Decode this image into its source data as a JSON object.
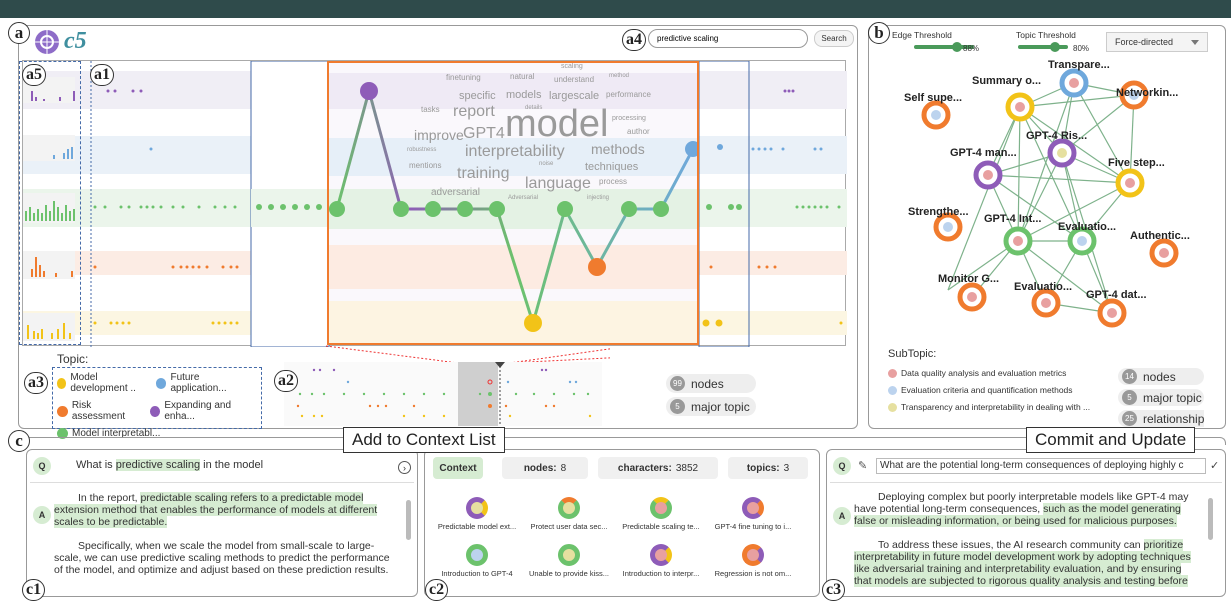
{
  "app": {
    "logo": "c5"
  },
  "labels": {
    "a": "a",
    "a1": "a1",
    "a2": "a2",
    "a3": "a3",
    "a4": "a4",
    "a5": "a5",
    "b": "b",
    "c": "c",
    "c1": "c1",
    "c2": "c2",
    "c3": "c3"
  },
  "search": {
    "value": "predictive scaling",
    "button": "Search"
  },
  "topics": {
    "title": "Topic:",
    "items": [
      {
        "label": "Model development ..",
        "color": "#f2c318"
      },
      {
        "label": "Future application...",
        "color": "#6fa8dc"
      },
      {
        "label": "Risk assessment",
        "color": "#f07b2e"
      },
      {
        "label": "Expanding and enha...",
        "color": "#8e5cb8"
      },
      {
        "label": "Model interpretabl...",
        "color": "#6cc26c"
      }
    ]
  },
  "stats_a": {
    "nodes": "99",
    "nodes_label": "nodes",
    "topics": "5",
    "topics_label": "major topic"
  },
  "wordcloud": [
    "scaling",
    "finetuning",
    "natural",
    "understand",
    "method",
    "specific",
    "models",
    "largescale",
    "performance",
    "tasks",
    "report",
    "details",
    "processing",
    "improve",
    "GPT4",
    "model",
    "author",
    "robustness",
    "interpretability",
    "methods",
    "mentions",
    "noise",
    "techniques",
    "training",
    "process",
    "language",
    "adversarial",
    "Adversarial",
    "injecting"
  ],
  "graph": {
    "edge_threshold_label": "Edge Threshold",
    "edge_threshold": "88%",
    "topic_threshold_label": "Topic Threshold",
    "topic_threshold": "80%",
    "layout": "Force-directed",
    "nodes": [
      "Transpare...",
      "Summary o...",
      "Networkin...",
      "Self supe...",
      "GPT-4 Ris...",
      "GPT-4 man...",
      "Five step...",
      "Strengthe...",
      "GPT-4 Int...",
      "Evaluatio...",
      "Authentic...",
      "Monitor G...",
      "Evaluatio...",
      "GPT-4 dat..."
    ],
    "subtopic_title": "SubTopic:",
    "subtopics": [
      {
        "label": "Data quality analysis and evaluation metrics",
        "color": "#e8a0a0"
      },
      {
        "label": "Evaluation criteria and quantification methods",
        "color": "#bcd3ee"
      },
      {
        "label": "Transparency and interpretability in dealing with ...",
        "color": "#e6e0a0"
      }
    ],
    "stats": {
      "nodes": "14",
      "nodes_label": "nodes",
      "topics": "5",
      "topics_label": "major topic",
      "rel": "25",
      "rel_label": "relationships"
    }
  },
  "qa1": {
    "q_badge": "Q",
    "a_badge": "A",
    "q_pre": "What is ",
    "q_hl": "predictive scaling",
    "q_post": " in the model",
    "a1_pre": "In the report, ",
    "a1_hl": "predictable scaling refers to a predictable model extension method that enables the performance of models at different scales to be predictable.",
    "a2": "Specifically, when we scale the model from small-scale to large-scale, we can use predictive scaling methods to predict the performance of the model, and optimize and adjust based on these prediction results."
  },
  "callouts": {
    "add": "Add to Context List",
    "commit": "Commit and Update"
  },
  "context": {
    "tab": "Context",
    "nodes_label": "nodes:",
    "nodes": "8",
    "chars_label": "characters:",
    "chars": "3852",
    "topics_label": "topics:",
    "topics": "3",
    "items": [
      "Predictable model ext...",
      "Protect user data sec...",
      "Predictable scaling te...",
      "GPT-4 fine tuning to i...",
      "Introduction to GPT-4",
      "Unable to provide kiss...",
      "Introduction to interpr...",
      "Regression is not om..."
    ]
  },
  "qa3": {
    "q_badge": "Q",
    "a_badge": "A",
    "question": "What are the potential long-term consequences of deploying highly c",
    "a1_pre": "Deploying complex but poorly interpretable models like GPT-4 may have potential long-term consequences, ",
    "a1_hl": "such as the model generating false or misleading information, or being used for malicious purposes.",
    "a2_pre": "To address these issues, the AI research community can ",
    "a2_hl": "prioritize interpretability in future model development work by adopting techniques like adversarial training and interpretability evaluation, and by ensuring that models are subjected to rigorous quality analysis and testing before"
  }
}
